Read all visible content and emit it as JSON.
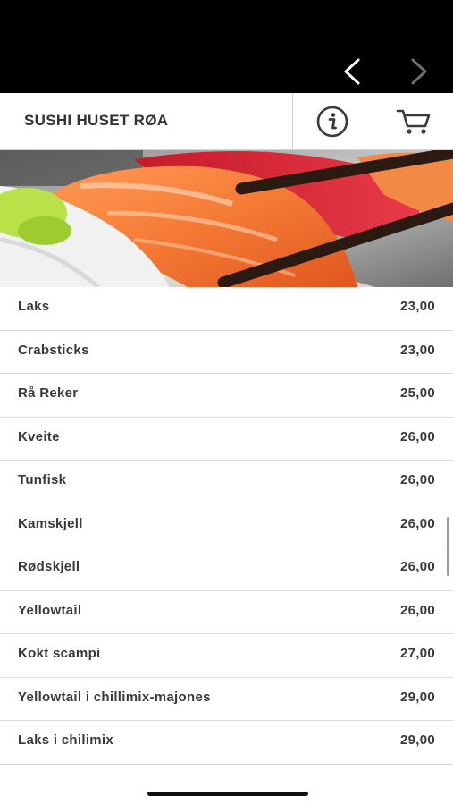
{
  "header": {
    "title": "SUSHI HUSET RØA",
    "info_icon": "info-circle-icon",
    "cart_icon": "shopping-cart-icon"
  },
  "navigation": {
    "back_icon": "chevron-left-icon",
    "forward_icon": "chevron-right-icon"
  },
  "colors": {
    "topbar": "#000000",
    "accent_salmon": "#f27a3a",
    "text": "#3a3a3a"
  },
  "menu": {
    "items": [
      {
        "name": "Laks",
        "price": "23,00"
      },
      {
        "name": "Crabsticks",
        "price": "23,00"
      },
      {
        "name": "Rå Reker",
        "price": "25,00"
      },
      {
        "name": "Kveite",
        "price": "26,00"
      },
      {
        "name": "Tunfisk",
        "price": "26,00"
      },
      {
        "name": "Kamskjell",
        "price": "26,00"
      },
      {
        "name": "Rødskjell",
        "price": "26,00"
      },
      {
        "name": "Yellowtail",
        "price": "26,00"
      },
      {
        "name": "Kokt scampi",
        "price": "27,00"
      },
      {
        "name": "Yellowtail i chillimix-majones",
        "price": "29,00"
      },
      {
        "name": "Laks i chilimix",
        "price": "29,00"
      }
    ]
  }
}
